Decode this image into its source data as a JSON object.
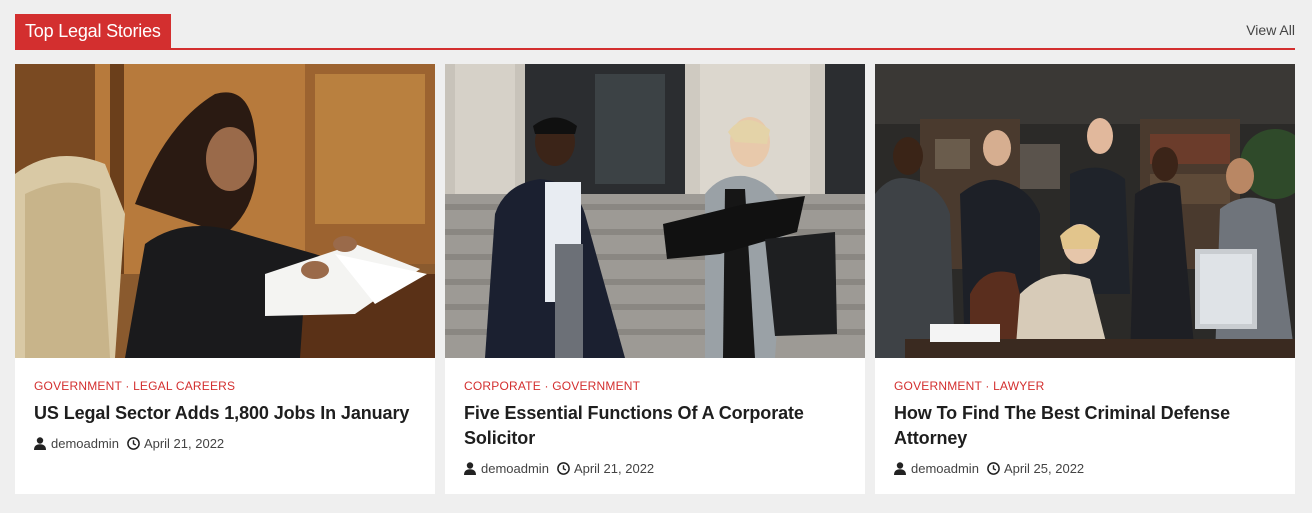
{
  "section": {
    "title": "Top Legal Stories",
    "view_all": "View All",
    "accent_color": "#d32f2f"
  },
  "cards": [
    {
      "categories": [
        "GOVERNMENT",
        "LEGAL CAREERS"
      ],
      "separator": " · ",
      "title": "US Legal Sector Adds 1,800 Jobs In January",
      "author": "demoadmin",
      "date": "April 21, 2022",
      "image": "woman-signing-documents-at-desk-photo"
    },
    {
      "categories": [
        "CORPORATE",
        "GOVERNMENT"
      ],
      "separator": " · ",
      "title": "Five Essential Functions Of A Corporate Solicitor",
      "author": "demoadmin",
      "date": "April 21, 2022",
      "image": "two-women-talking-on-courthouse-steps-photo"
    },
    {
      "categories": [
        "GOVERNMENT",
        "LAWYER"
      ],
      "separator": " · ",
      "title": "How To Find The Best Criminal Defense Attorney",
      "author": "demoadmin",
      "date": "April 25, 2022",
      "image": "law-firm-team-group-portrait-photo"
    }
  ]
}
